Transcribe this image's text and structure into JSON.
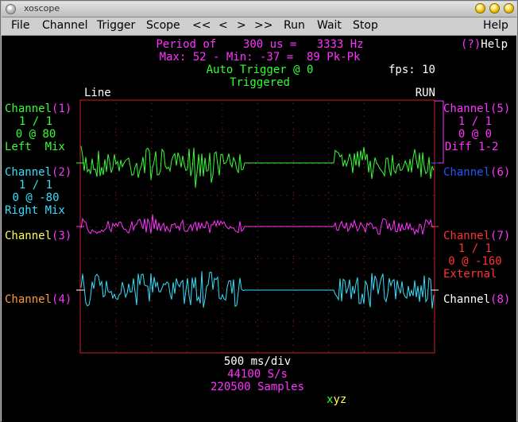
{
  "window": {
    "title": "xoscope"
  },
  "menu": [
    "File",
    "Channel",
    "Trigger",
    "Scope",
    "<<",
    "<",
    ">",
    ">>",
    "Run",
    "Wait",
    "Stop",
    "Help"
  ],
  "header": {
    "period": "Period of    300 us =   3333 Hz",
    "minmax": "Max: 52 - Min: -37 =  89 Pk-Pk",
    "trigger": "Auto Trigger @ 0",
    "triggered": "Triggered",
    "help": "(?)Help",
    "fps": "fps: 10"
  },
  "scope": {
    "left_label": "Line",
    "right_label": "RUN"
  },
  "channels_left": [
    {
      "name": "Channel(1)",
      "lines": [
        "1 / 1",
        "0 @ 80",
        "Left  Mix"
      ],
      "color": "#33ff33"
    },
    {
      "name": "Channel(2)",
      "lines": [
        "1 / 1",
        "0 @ -80",
        "Right Mix"
      ],
      "color": "#33e0ff"
    },
    {
      "name": "Channel(3)",
      "lines": [],
      "color": "#ffff55"
    },
    {
      "name": "Channel(4)",
      "lines": [],
      "color": "#ff9933"
    }
  ],
  "channels_right": [
    {
      "name": "Channel(5)",
      "lines": [
        "1 / 1",
        "0 @ 0",
        "Diff 1-2"
      ],
      "color": "#ff33ff"
    },
    {
      "name": "Channel(6)",
      "lines": [],
      "color": "#2255ff"
    },
    {
      "name": "Channel(7)",
      "lines": [
        "1 / 1",
        "0 @ -160",
        "External"
      ],
      "color": "#ff3333"
    },
    {
      "name": "Channel(8)",
      "lines": [],
      "color": "#ffffff"
    }
  ],
  "footer": {
    "timebase": "500 ms/div",
    "rate": "44100 S/s",
    "samples": "220500 Samples",
    "mode": "xyz"
  },
  "colors": {
    "green": "#33ff33",
    "cyan": "#33e0ff",
    "magenta": "#ff33ff",
    "red": "#cc2222",
    "white": "#ffffff",
    "yellow": "#ffff55",
    "orange": "#ff9933",
    "blue": "#2255ff",
    "grid": "#cc2222"
  }
}
